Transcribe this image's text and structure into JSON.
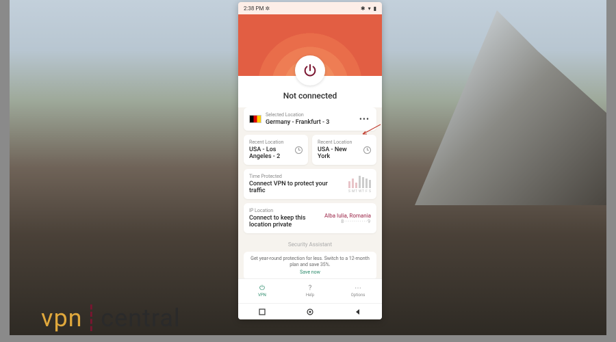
{
  "statusbar": {
    "time": "2:38 PM",
    "dnd_icon": "✲",
    "bt_icon": "✱",
    "wifi_icon": "▾",
    "battery_icon": "▮"
  },
  "connection_status": "Not connected",
  "selected_location": {
    "label": "Selected Location",
    "value": "Germany - Frankfurt - 3"
  },
  "recent": [
    {
      "label": "Recent Location",
      "value": "USA - Los Angeles - 2"
    },
    {
      "label": "Recent Location",
      "value": "USA - New York"
    }
  ],
  "time_protected": {
    "label": "Time Protected",
    "value": "Connect VPN to protect your traffic",
    "days": [
      "S",
      "M",
      "T",
      "W",
      "T",
      "F",
      "S"
    ]
  },
  "ip_location": {
    "label": "IP Location",
    "value": "Connect to keep this location private",
    "city": "Alba Iulia, Romania",
    "masked": "8············9"
  },
  "security_assistant": "Security Assistant",
  "promo": {
    "text": "Get year-round protection for less. Switch to a 12-month plan and save 35%.",
    "cta": "Save now"
  },
  "nav": {
    "vpn": "VPN",
    "help": "Help",
    "options": "Options"
  },
  "watermark": {
    "vpn": "vpn",
    "central": "central"
  }
}
